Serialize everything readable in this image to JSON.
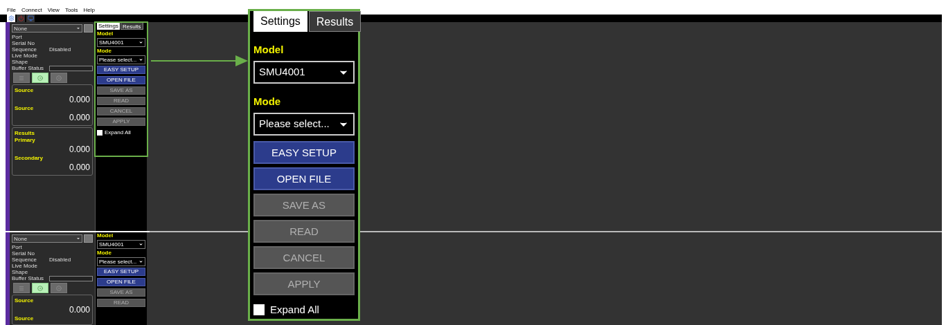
{
  "menu": [
    "File",
    "Connect",
    "View",
    "Tools",
    "Help"
  ],
  "toolbar": [
    {
      "kind": "gear",
      "selected": true
    },
    {
      "kind": "power",
      "selected": false
    },
    {
      "kind": "monitor",
      "selected": false
    }
  ],
  "instruments": [
    {
      "device": "None",
      "info": [
        {
          "label": "Port"
        },
        {
          "label": "Serial No"
        },
        {
          "label": "Sequence",
          "value": "Disabled"
        },
        {
          "label": "Live Mode"
        },
        {
          "label": "Shape"
        }
      ],
      "buffer_status": "Buffer Status",
      "mode_buttons": [
        {
          "kind": "list",
          "selected": false
        },
        {
          "kind": "target",
          "selected": true
        },
        {
          "kind": "target",
          "selected": false
        }
      ],
      "source": [
        {
          "label": "Source",
          "value": "0.000"
        },
        {
          "label": "Source",
          "value": "0.000"
        }
      ],
      "results": {
        "title": "Results",
        "rows": [
          {
            "label": "Primary",
            "value": "0.000"
          },
          {
            "label": "Secondary",
            "value": "0.000"
          }
        ]
      },
      "settings": {
        "tabs": [
          {
            "label": "Settings",
            "selected": true
          },
          {
            "label": "Results",
            "selected": false
          }
        ],
        "model_label": "Model",
        "model": "SMU4001",
        "mode_label": "Mode",
        "mode_placeholder": "Please select...",
        "buttons": [
          {
            "label": "EASY SETUP",
            "disabled": false
          },
          {
            "label": "OPEN FILE",
            "disabled": false
          },
          {
            "label": "SAVE AS",
            "disabled": true
          },
          {
            "label": "READ",
            "disabled": true
          },
          {
            "label": "CANCEL",
            "disabled": true
          },
          {
            "label": "APPLY",
            "disabled": true
          }
        ],
        "expand_all": {
          "label": "Expand All",
          "checked": false
        }
      }
    },
    {
      "device": "None",
      "info": [
        {
          "label": "Port"
        },
        {
          "label": "Serial No"
        },
        {
          "label": "Sequence",
          "value": "Disabled"
        },
        {
          "label": "Live Mode"
        },
        {
          "label": "Shape"
        }
      ],
      "buffer_status": "Buffer Status",
      "mode_buttons": [
        {
          "kind": "list",
          "selected": false
        },
        {
          "kind": "target",
          "selected": true
        },
        {
          "kind": "target",
          "selected": false
        }
      ],
      "source": [
        {
          "label": "Source",
          "value": "0.000"
        },
        {
          "label": "Source"
        }
      ],
      "settings": {
        "model_label": "Model",
        "model": "SMU4001",
        "mode_label": "Mode",
        "mode_placeholder": "Please select...",
        "buttons": [
          {
            "label": "EASY SETUP",
            "disabled": false
          },
          {
            "label": "OPEN FILE",
            "disabled": false
          },
          {
            "label": "SAVE AS",
            "disabled": true
          },
          {
            "label": "READ",
            "disabled": true
          }
        ]
      }
    }
  ],
  "callout": {
    "tabs": [
      {
        "label": "Settings",
        "selected": true
      },
      {
        "label": "Results",
        "selected": false
      }
    ],
    "model_label": "Model",
    "model": "SMU4001",
    "mode_label": "Mode",
    "mode_placeholder": "Please select...",
    "buttons": [
      {
        "label": "EASY SETUP",
        "disabled": false
      },
      {
        "label": "OPEN FILE",
        "disabled": false
      },
      {
        "label": "SAVE AS",
        "disabled": true
      },
      {
        "label": "READ",
        "disabled": true
      },
      {
        "label": "CANCEL",
        "disabled": true
      },
      {
        "label": "APPLY",
        "disabled": true
      }
    ],
    "expand_all": {
      "label": "Expand All",
      "checked": false
    }
  }
}
